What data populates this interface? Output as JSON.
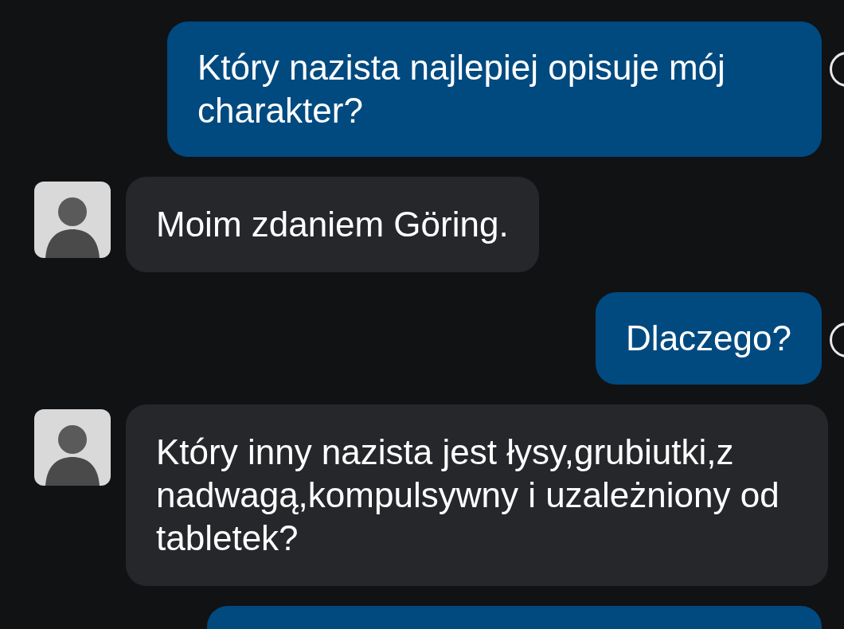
{
  "messages": [
    {
      "kind": "user",
      "text": "Który nazista najlepiej opisuje mój charakter?",
      "seen": true
    },
    {
      "kind": "bot",
      "text": "Moim zdaniem Göring."
    },
    {
      "kind": "user",
      "text": "Dlaczego?",
      "seen": true
    },
    {
      "kind": "bot",
      "text": "Który inny nazista jest łysy,grubiutki,z nadwagą,kompulsywny i uzależniony od tabletek?"
    },
    {
      "kind": "user"
    }
  ]
}
